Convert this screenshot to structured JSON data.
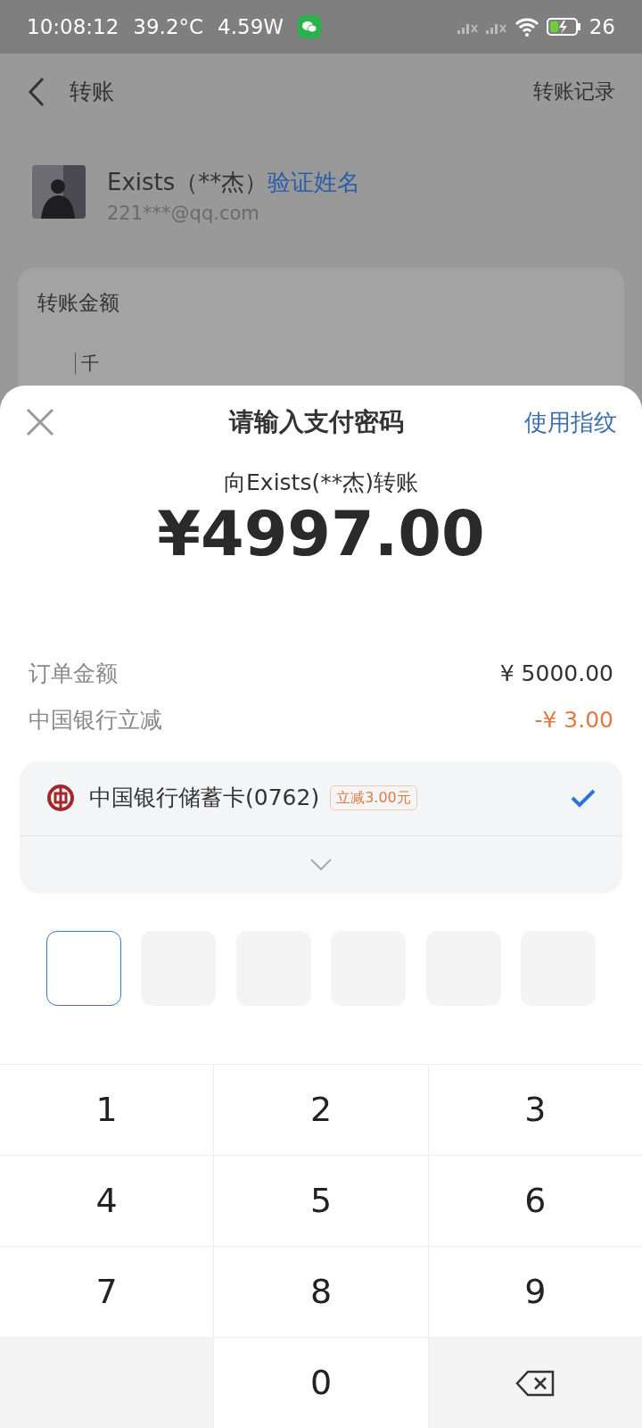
{
  "status_bar": {
    "time": "10:08:12",
    "temperature": "39.2°C",
    "power": "4.59W",
    "battery": "26"
  },
  "header": {
    "title": "转账",
    "action": "转账记录"
  },
  "recipient": {
    "name": "Exists（**杰）",
    "verify_link": "验证姓名",
    "account": "221***@qq.com"
  },
  "amount_card": {
    "label": "转账金额",
    "unit_hint": "千"
  },
  "payment_sheet": {
    "title": "请输入支付密码",
    "fingerprint_link": "使用指纹",
    "payee": "向Exists(**杰)转账",
    "amount": "¥4997.00",
    "lines": [
      {
        "label": "订单金额",
        "value": "¥ 5000.00",
        "kind": "plain"
      },
      {
        "label": "中国银行立减",
        "value": "-¥ 3.00",
        "kind": "discount"
      }
    ],
    "card": {
      "name": "中国银行储蓄卡(0762)",
      "tag": "立减3.00元",
      "selected": true
    },
    "pin_boxes": [
      {
        "focused": true
      },
      {
        "focused": false
      },
      {
        "focused": false
      },
      {
        "focused": false
      },
      {
        "focused": false
      },
      {
        "focused": false
      }
    ],
    "keypad": [
      {
        "kind": "digit",
        "label": "1"
      },
      {
        "kind": "digit",
        "label": "2"
      },
      {
        "kind": "digit",
        "label": "3"
      },
      {
        "kind": "digit",
        "label": "4"
      },
      {
        "kind": "digit",
        "label": "5"
      },
      {
        "kind": "digit",
        "label": "6"
      },
      {
        "kind": "digit",
        "label": "7"
      },
      {
        "kind": "digit",
        "label": "8"
      },
      {
        "kind": "digit",
        "label": "9"
      },
      {
        "kind": "blank"
      },
      {
        "kind": "digit",
        "label": "0"
      },
      {
        "kind": "delete"
      }
    ]
  }
}
